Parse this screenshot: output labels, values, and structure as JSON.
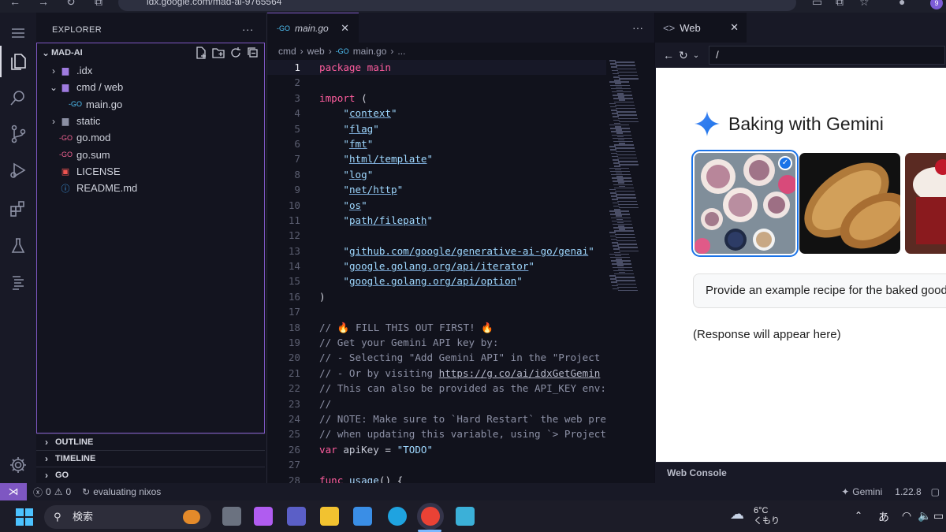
{
  "browser": {
    "url": "idx.google.com/mad-ai-9765564",
    "badge": "9"
  },
  "explorer": {
    "header": "EXPLORER",
    "more": "···",
    "project": "MAD-AI",
    "items": [
      {
        "label": ".idx",
        "type": "folder",
        "chev": "›"
      },
      {
        "label": "cmd / web",
        "type": "folder-open",
        "chev": "⌄"
      },
      {
        "label": "main.go",
        "type": "go"
      },
      {
        "label": "static",
        "type": "folder",
        "chev": "›"
      },
      {
        "label": "go.mod",
        "type": "gomod"
      },
      {
        "label": "go.sum",
        "type": "gomod"
      },
      {
        "label": "LICENSE",
        "type": "license"
      },
      {
        "label": "README.md",
        "type": "info"
      }
    ],
    "sections": [
      "OUTLINE",
      "TIMELINE",
      "GO"
    ]
  },
  "editor": {
    "tab": "main.go",
    "tab_close": "✕",
    "more": "···",
    "breadcrumb": [
      "cmd",
      "web",
      "main.go",
      "..."
    ],
    "lines": [
      "package main",
      "",
      "import (",
      "\"context\"",
      "\"flag\"",
      "\"fmt\"",
      "\"html/template\"",
      "\"log\"",
      "\"net/http\"",
      "\"os\"",
      "\"path/filepath\"",
      "",
      "\"github.com/google/generative-ai-go/genai\"",
      "\"google.golang.org/api/iterator\"",
      "\"google.golang.org/api/option\"",
      ")",
      "",
      "// 🔥 FILL THIS OUT FIRST! 🔥",
      "// Get your Gemini API key by:",
      "// - Selecting \"Add Gemini API\" in the \"Project",
      "// - Or by visiting https://g.co/ai/idxGetGemin",
      "// This can also be provided as the API_KEY env:",
      "//",
      "// NOTE: Make sure to `Hard Restart` the web pre",
      "// when updating this variable, using `> Project",
      "var apiKey = \"TODO\"",
      "",
      "func usage() {"
    ]
  },
  "web": {
    "tab": "Web",
    "tab_close": "✕",
    "address": "/",
    "page_title": "Baking with Gemini",
    "prompt": "Provide an example recipe for the baked goods",
    "response": "(Response will appear here)",
    "console": "Web Console"
  },
  "status": {
    "problems": "0",
    "warnings": "0",
    "task": "evaluating nixos",
    "gemini": "Gemini",
    "go_version": "1.22.8"
  },
  "taskbar": {
    "search": "検索",
    "temp": "6°C",
    "weather": "くもり",
    "ime": "あ"
  }
}
